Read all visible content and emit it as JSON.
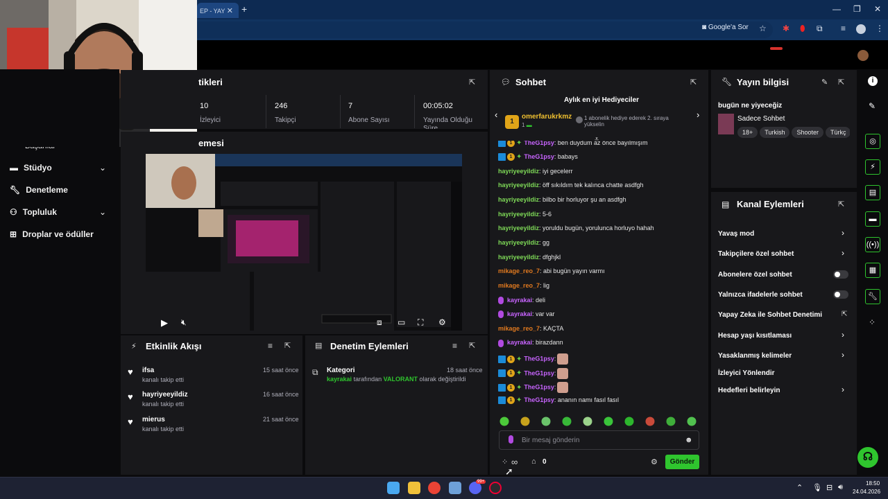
{
  "browser": {
    "tab_title": "EP - YAY",
    "google_ask": "Google'a Sor"
  },
  "sidebar": {
    "cut_label": "Başarılar",
    "items": [
      {
        "label": "Stüdyo",
        "icon": "studio-icon",
        "expandable": true
      },
      {
        "label": "Denetleme",
        "icon": "wrench-icon",
        "expandable": false
      },
      {
        "label": "Topluluk",
        "icon": "community-icon",
        "expandable": true
      },
      {
        "label": "Droplar ve ödüller",
        "icon": "drops-icon",
        "expandable": false
      }
    ]
  },
  "stats": {
    "title": "tikleri",
    "items": [
      {
        "value": "10",
        "label": "İzleyici"
      },
      {
        "value": "246",
        "label": "Takipçi"
      },
      {
        "value": "7",
        "label": "Abone Sayısı"
      },
      {
        "value": "00:05:02",
        "label": "Yayında Olduğu Süre"
      }
    ]
  },
  "preview": {
    "title": "emesi"
  },
  "activity": {
    "title": "Etkinlik Akışı",
    "items": [
      {
        "name": "ifsa",
        "action": "kanalı takip etti",
        "time": "15 saat önce"
      },
      {
        "name": "hayriyeeyildiz",
        "action": "kanalı takip etti",
        "time": "16 saat önce"
      },
      {
        "name": "mierus",
        "action": "kanalı takip etti",
        "time": "21 saat önce"
      }
    ]
  },
  "moderation": {
    "title": "Denetim Eylemleri",
    "item": {
      "title": "Kategori",
      "actor": "kayrakai",
      "mid": "tarafından",
      "value": "VALORANT",
      "tail": "olarak değiştirildi",
      "time": "18 saat önce"
    }
  },
  "chat": {
    "title": "Sohbet",
    "gifters_title": "Aylık en iyi Hediyeciler",
    "top_gifter": "omerfarukrkmz",
    "top_gifter_rank": "1",
    "top_gifter_count": "1",
    "gifter_hint": "1 abonelik hediye ederek 2. sıraya yükselin",
    "partial_line": {
      "user": "TheG1psy",
      "text": ": ben duydum az önce bayılmışım"
    },
    "messages": [
      {
        "user": "TheG1psy",
        "color": "purple",
        "badges": "sub",
        "text": ": babays"
      },
      {
        "user": "hayriyeeyildiz",
        "color": "green",
        "badges": "none",
        "text": ": iyi gecelerr"
      },
      {
        "user": "hayriyeeyildiz",
        "color": "green",
        "badges": "none",
        "text": ": öff sıkıldım tek kalınca chatte asdfgh"
      },
      {
        "user": "hayriyeeyildiz",
        "color": "green",
        "badges": "none",
        "text": ": bilbo bir horluyor şu an asdfgh"
      },
      {
        "user": "hayriyeeyildiz",
        "color": "green",
        "badges": "none",
        "text": ": 5-6"
      },
      {
        "user": "hayriyeeyildiz",
        "color": "green",
        "badges": "none",
        "text": ": yoruldu bugün, yorulunca horluyo hahah"
      },
      {
        "user": "hayriyeeyildiz",
        "color": "green",
        "badges": "none",
        "text": ": gg"
      },
      {
        "user": "hayriyeeyildiz",
        "color": "green",
        "badges": "none",
        "text": ": dfghjkl"
      },
      {
        "user": "mikage_reo_7",
        "color": "orange",
        "badges": "none",
        "text": ": abi bugün yayın varmı"
      },
      {
        "user": "mikage_reo_7",
        "color": "orange",
        "badges": "none",
        "text": ": lig"
      },
      {
        "user": "kayrakai",
        "color": "purple",
        "badges": "mic",
        "text": ": deli"
      },
      {
        "user": "kayrakai",
        "color": "purple",
        "badges": "mic",
        "text": ": var var"
      },
      {
        "user": "mikage_reo_7",
        "color": "orange",
        "badges": "none",
        "text": ": KAÇTA"
      },
      {
        "user": "kayrakai",
        "color": "purple",
        "badges": "mic",
        "text": ": birazdann"
      },
      {
        "user": "TheG1psy",
        "color": "purple",
        "badges": "sub",
        "text": ":",
        "emote": true
      },
      {
        "user": "TheG1psy",
        "color": "purple",
        "badges": "sub",
        "text": ":",
        "emote": true
      },
      {
        "user": "TheG1psy",
        "color": "purple",
        "badges": "sub",
        "text": ":",
        "emote": true
      },
      {
        "user": "TheG1psy",
        "color": "purple",
        "badges": "sub",
        "text": ": ananın namı fasıl fasıl"
      }
    ],
    "input_placeholder": "Bir mesaj gönderin",
    "points": "0",
    "send_label": "Gönder"
  },
  "stream_info": {
    "title": "Yayın bilgisi",
    "stream_title": "bugün ne yiyeceğiz",
    "category": "Sadece Sohbet",
    "tags": [
      "18+",
      "Turkish",
      "Shooter",
      "Türkç"
    ]
  },
  "channel_actions": {
    "title": "Kanal Eylemleri",
    "items": [
      {
        "label": "Yavaş mod",
        "control": "chevron"
      },
      {
        "label": "Takipçilere özel sohbet",
        "control": "chevron"
      },
      {
        "label": "Abonelere özel sohbet",
        "control": "toggle"
      },
      {
        "label": "Yalnızca ifadelerle sohbet",
        "control": "toggle"
      },
      {
        "label": "Yapay Zeka ile Sohbet Denetimi",
        "control": "external"
      },
      {
        "label": "Hesap yaşı kısıtlaması",
        "control": "chevron"
      },
      {
        "label": "Yasaklanmış kelimeler",
        "control": "chevron"
      },
      {
        "label": "İzleyici Yönlendir",
        "control": "none"
      },
      {
        "label": "Hedefleri belirleyin",
        "control": "chevron"
      }
    ]
  },
  "taskbar": {
    "time": "18:50",
    "date": "24.04.2026",
    "discord_badge": "99+"
  },
  "colors": {
    "accent": "#2fc52e",
    "panel": "#18181b",
    "background": "#0b0b0d"
  }
}
